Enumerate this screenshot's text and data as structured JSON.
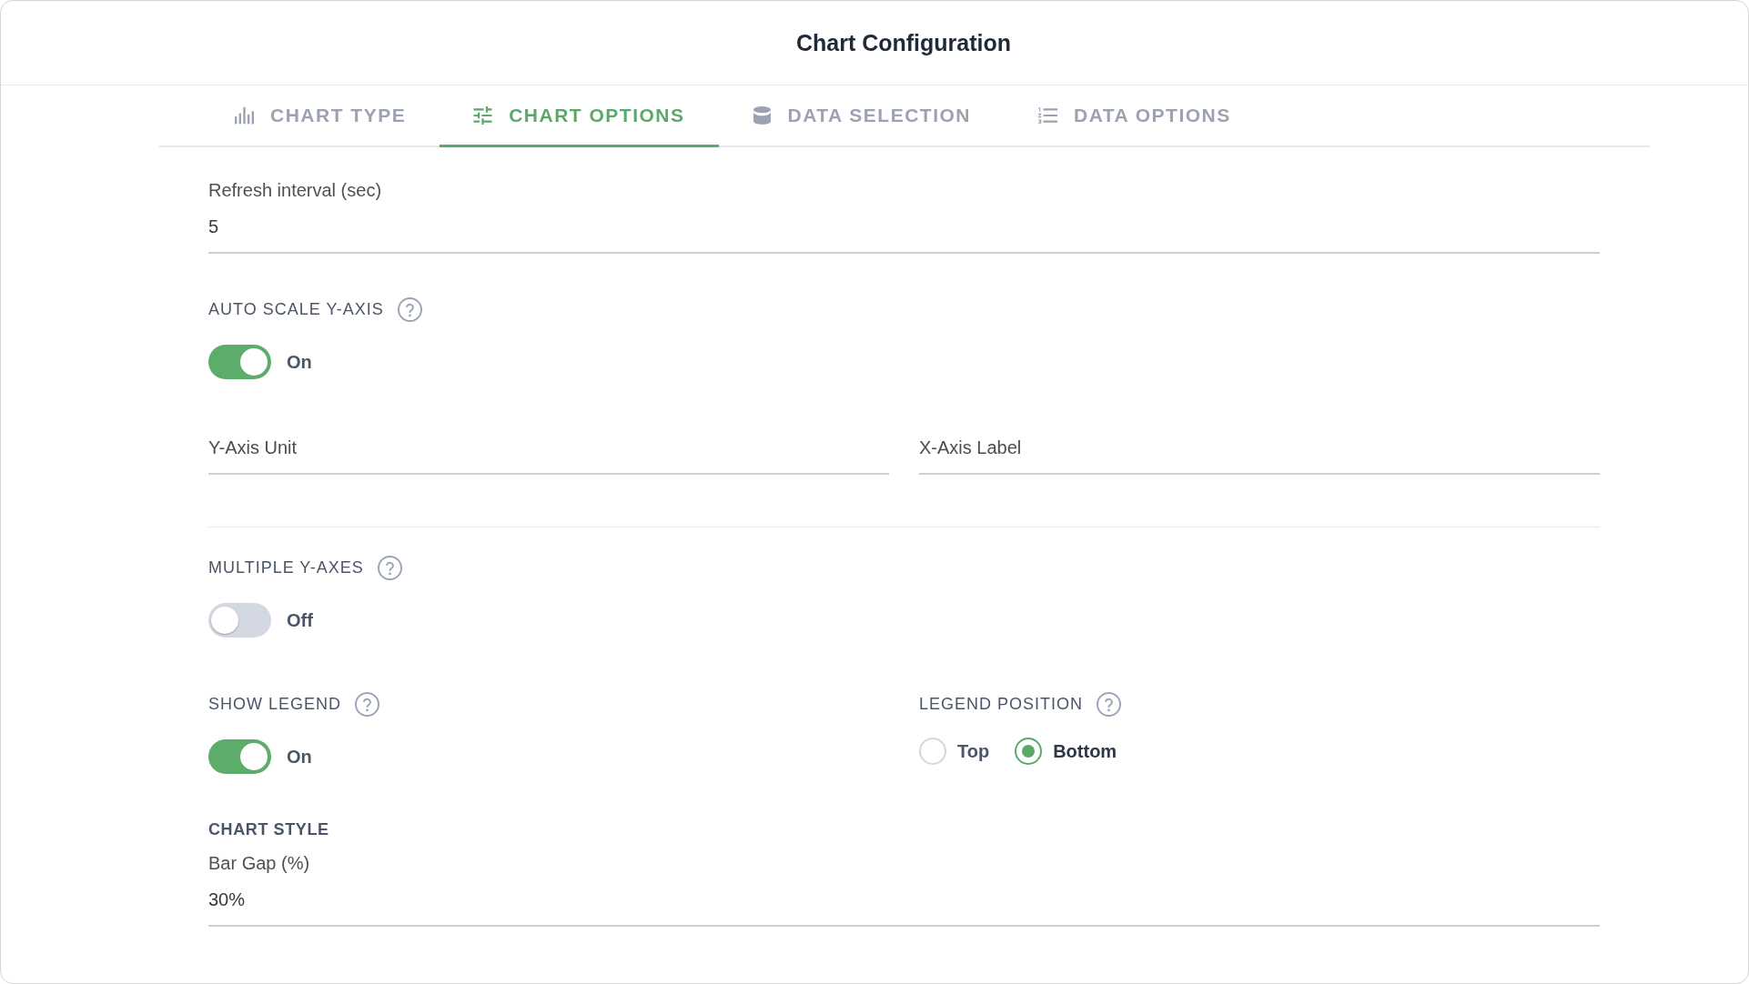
{
  "window": {
    "title": "Chart Configuration"
  },
  "tabs": [
    {
      "label": "CHART TYPE",
      "selected": false
    },
    {
      "label": "CHART OPTIONS",
      "selected": true
    },
    {
      "label": "DATA SELECTION",
      "selected": false
    },
    {
      "label": "DATA OPTIONS",
      "selected": false
    }
  ],
  "refresh_interval": {
    "label": "Refresh interval (sec)",
    "value": "5"
  },
  "auto_scale_y_axis": {
    "label": "AUTO SCALE Y-AXIS",
    "on": true,
    "state_label": "On"
  },
  "axis_fields": [
    {
      "placeholder": "Y-Axis Unit"
    },
    {
      "placeholder": "X-Axis Label"
    }
  ],
  "multiple_y_axes": {
    "label": "MULTIPLE Y-AXES",
    "on": false,
    "state_label": "Off"
  },
  "show_legend": {
    "label": "SHOW LEGEND",
    "on": true,
    "state_label": "On"
  },
  "legend_position": {
    "label": "LEGEND POSITION",
    "options": [
      {
        "label": "Top",
        "selected": false
      },
      {
        "label": "Bottom",
        "selected": true
      }
    ]
  },
  "chart_style": {
    "heading": "CHART STYLE",
    "bar_gap": {
      "label": "Bar Gap (%)",
      "value": "30%"
    }
  }
}
